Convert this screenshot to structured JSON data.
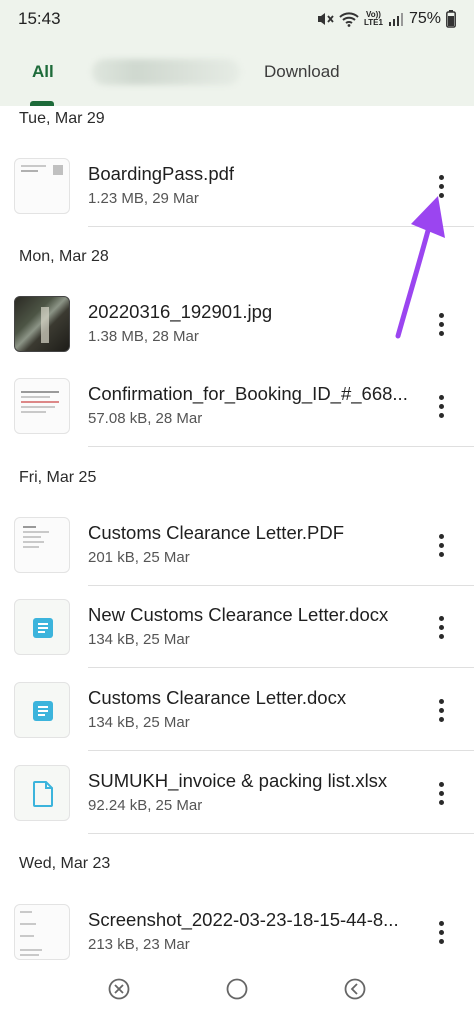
{
  "status": {
    "time": "15:43",
    "volte_top": "Vo))",
    "volte_bottom": "LTE1",
    "battery": "75%",
    "icons": [
      "mute-icon",
      "wifi-icon",
      "volte-icon",
      "signal-icon",
      "battery-icon"
    ]
  },
  "tabs": {
    "all": "All",
    "download": "Download"
  },
  "sections": [
    {
      "date": "Tue, Mar 29",
      "files": [
        {
          "name": "BoardingPass.pdf",
          "meta": "1.23 MB, 29 Mar",
          "thumb": "pdf-thumbnail"
        }
      ]
    },
    {
      "date": "Mon, Mar 28",
      "files": [
        {
          "name": "20220316_192901.jpg",
          "meta": "1.38 MB, 28 Mar",
          "thumb": "photo-thumbnail"
        },
        {
          "name": "Confirmation_for_Booking_ID_#_668...",
          "meta": "57.08 kB, 28 Mar",
          "thumb": "pdf-thumbnail"
        }
      ]
    },
    {
      "date": "Fri, Mar 25",
      "files": [
        {
          "name": "Customs Clearance Letter.PDF",
          "meta": "201 kB, 25 Mar",
          "thumb": "pdf-thumbnail"
        },
        {
          "name": "New Customs Clearance Letter.docx",
          "meta": "134 kB, 25 Mar",
          "thumb": "document-icon"
        },
        {
          "name": "Customs Clearance Letter.docx",
          "meta": "134 kB, 25 Mar",
          "thumb": "document-icon"
        },
        {
          "name": "SUMUKH_invoice & packing list.xlsx",
          "meta": "92.24 kB, 25 Mar",
          "thumb": "file-icon"
        }
      ]
    },
    {
      "date": "Wed, Mar 23",
      "files": [
        {
          "name": "Screenshot_2022-03-23-18-15-44-8...",
          "meta": "213 kB, 23 Mar",
          "thumb": "screenshot-thumbnail"
        }
      ]
    }
  ],
  "colors": {
    "accent": "#1e6b3a",
    "header_bg": "#eef3ec",
    "doc_icon": "#3cb4dc",
    "annotation_arrow": "#9b45f0"
  },
  "navbar": [
    "recents-icon",
    "home-icon",
    "back-icon"
  ]
}
